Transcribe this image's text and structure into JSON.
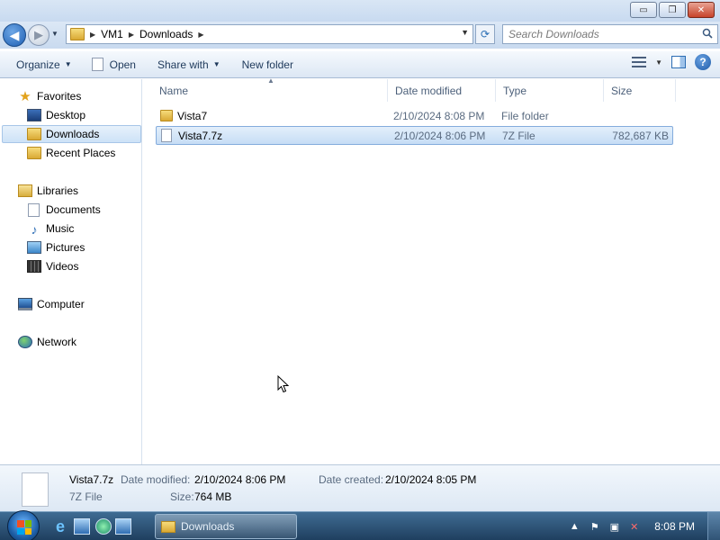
{
  "window": {
    "buttons": {
      "minimize": "▭",
      "restore": "❐",
      "close": "✕"
    }
  },
  "address": {
    "crumbs": [
      "VM1",
      "Downloads"
    ],
    "search_placeholder": "Search Downloads"
  },
  "toolbar": {
    "organize": "Organize",
    "open": "Open",
    "share_with": "Share with",
    "new_folder": "New folder"
  },
  "nav": {
    "favorites": "Favorites",
    "desktop": "Desktop",
    "downloads": "Downloads",
    "recent_places": "Recent Places",
    "libraries": "Libraries",
    "documents": "Documents",
    "music": "Music",
    "pictures": "Pictures",
    "videos": "Videos",
    "computer": "Computer",
    "network": "Network"
  },
  "columns": {
    "name": "Name",
    "date_modified": "Date modified",
    "type": "Type",
    "size": "Size"
  },
  "files": [
    {
      "name": "Vista7",
      "date_modified": "2/10/2024 8:08 PM",
      "type": "File folder",
      "size": "",
      "selected": false
    },
    {
      "name": "Vista7.7z",
      "date_modified": "2/10/2024 8:06 PM",
      "type": "7Z File",
      "size": "782,687 KB",
      "selected": true
    }
  ],
  "details": {
    "name": "Vista7.7z",
    "type": "7Z File",
    "date_modified_label": "Date modified:",
    "date_modified": "2/10/2024 8:06 PM",
    "size_label": "Size:",
    "size": "764 MB",
    "date_created_label": "Date created:",
    "date_created": "2/10/2024 8:05 PM"
  },
  "taskbar": {
    "active_window": "Downloads",
    "clock": "8:08 PM"
  }
}
